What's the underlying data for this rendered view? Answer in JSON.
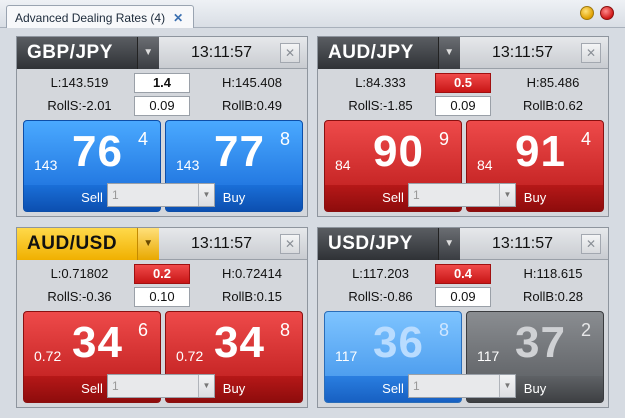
{
  "window": {
    "tab_title": "Advanced Dealing Rates (4)",
    "tab_close": "✕"
  },
  "panels": [
    {
      "pair": "GBP/JPY",
      "time": "13:11:57",
      "low": "L:143.519",
      "high": "H:145.408",
      "spread": "1.4",
      "roll_s": "RollS:-2.01",
      "roll_b": "RollB:0.49",
      "roll_box": "0.09",
      "sell": {
        "small": "143",
        "big": "76",
        "sup": "4",
        "label": "Sell"
      },
      "buy": {
        "small": "143",
        "big": "77",
        "sup": "8",
        "label": "Buy"
      },
      "qty": "1"
    },
    {
      "pair": "AUD/JPY",
      "time": "13:11:57",
      "low": "L:84.333",
      "high": "H:85.486",
      "spread": "0.5",
      "roll_s": "RollS:-1.85",
      "roll_b": "RollB:0.62",
      "roll_box": "0.09",
      "sell": {
        "small": "84",
        "big": "90",
        "sup": "9",
        "label": "Sell"
      },
      "buy": {
        "small": "84",
        "big": "91",
        "sup": "4",
        "label": "Buy"
      },
      "qty": "1"
    },
    {
      "pair": "AUD/USD",
      "time": "13:11:57",
      "low": "L:0.71802",
      "high": "H:0.72414",
      "spread": "0.2",
      "roll_s": "RollS:-0.36",
      "roll_b": "RollB:0.15",
      "roll_box": "0.10",
      "sell": {
        "small": "0.72",
        "big": "34",
        "sup": "6",
        "label": "Sell"
      },
      "buy": {
        "small": "0.72",
        "big": "34",
        "sup": "8",
        "label": "Buy"
      },
      "qty": "1"
    },
    {
      "pair": "USD/JPY",
      "time": "13:11:57",
      "low": "L:117.203",
      "high": "H:118.615",
      "spread": "0.4",
      "roll_s": "RollS:-0.86",
      "roll_b": "RollB:0.28",
      "roll_box": "0.09",
      "sell": {
        "small": "117",
        "big": "36",
        "sup": "8",
        "label": "Sell"
      },
      "buy": {
        "small": "117",
        "big": "37",
        "sup": "2",
        "label": "Buy"
      },
      "qty": "1"
    }
  ],
  "icons": {
    "dropdown": "▼",
    "close": "✕"
  },
  "colors": {
    "sell_blue": "#1466d6",
    "sell_red": "#b81818",
    "buy_gray": "#55585c",
    "pair_highlight": "#f0b000"
  }
}
